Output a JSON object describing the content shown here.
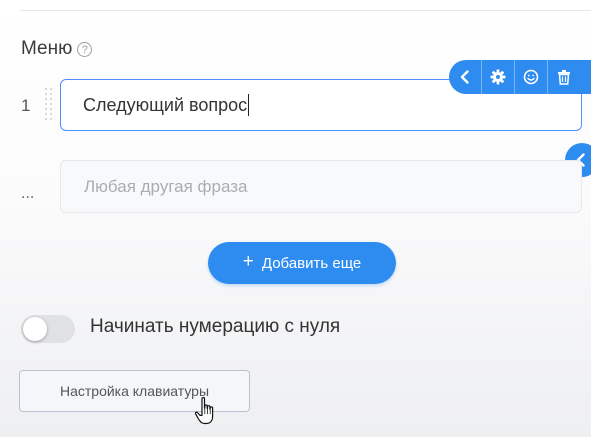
{
  "menu": {
    "title": "Меню",
    "help_icon": "question-circle-icon"
  },
  "items": [
    {
      "number": "1",
      "value": "Следующий вопрос"
    }
  ],
  "fallback": {
    "marker": "...",
    "placeholder": "Любая другая фраза"
  },
  "toolbar": {
    "icons": [
      "chevron-left-icon",
      "gear-icon",
      "smiley-icon",
      "trash-icon"
    ]
  },
  "add_button": {
    "icon": "plus",
    "label": "Добавить еще"
  },
  "numbering_toggle": {
    "label": "Начинать нумерацию с нуля",
    "enabled": false
  },
  "keyboard_button": {
    "label": "Настройка клавиатуры"
  },
  "colors": {
    "accent": "#2e8cf0",
    "input_border_active": "#4d90fe",
    "toggle_off": "#dfe1e5"
  }
}
